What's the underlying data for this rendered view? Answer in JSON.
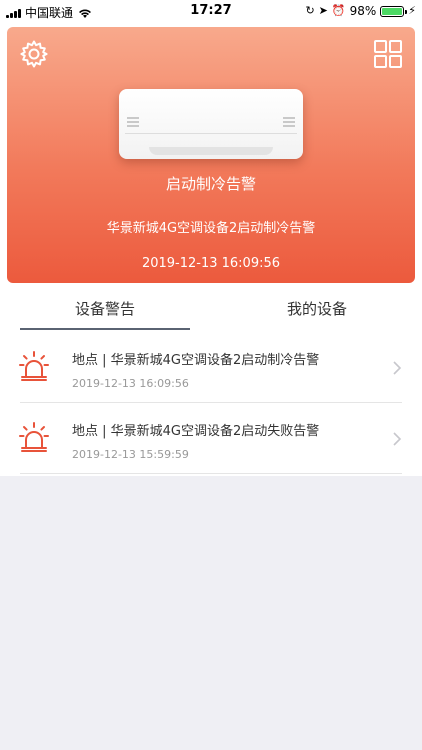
{
  "status_bar": {
    "carrier": "中国联通",
    "time": "17:27",
    "battery": "98%",
    "battery_level": 0.98
  },
  "hero": {
    "title": "启动制冷告警",
    "description": "华景新城4G空调设备2启动制冷告警",
    "timestamp": "2019-12-13 16:09:56",
    "icons": {
      "settings": "gear-icon",
      "menu": "grid-icon",
      "device": "air-conditioner"
    }
  },
  "tabs": [
    {
      "label": "设备警告",
      "active": true
    },
    {
      "label": "我的设备",
      "active": false
    }
  ],
  "alerts": [
    {
      "title": "地点 | 华景新城4G空调设备2启动制冷告警",
      "time": "2019-12-13 16:09:56",
      "icon": "alarm-light-icon"
    },
    {
      "title": "地点 | 华景新城4G空调设备2启动失败告警",
      "time": "2019-12-13 15:59:59",
      "icon": "alarm-light-icon"
    }
  ],
  "colors": {
    "accent": "#ec5a3d",
    "alarm_icon": "#e8533a",
    "tab_indicator": "#5a6372",
    "background": "#efeff4"
  }
}
